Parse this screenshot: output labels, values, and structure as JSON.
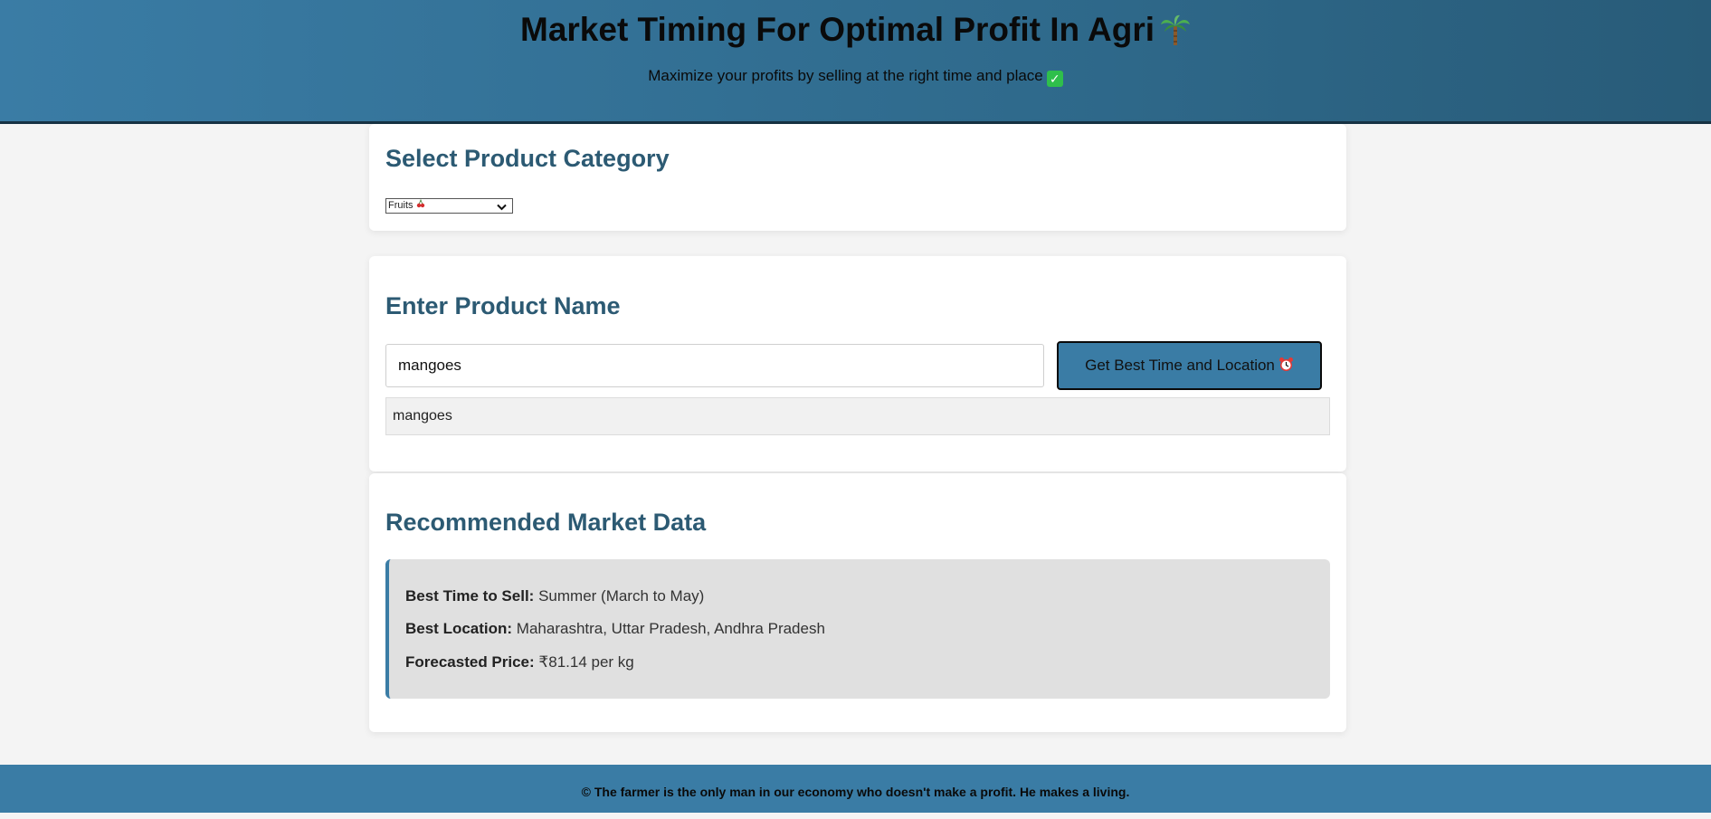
{
  "header": {
    "title": "Market Timing For Optimal Profit In Agri",
    "title_icon": "palm-tree-icon",
    "subtitle": "Maximize your profits by selling at the right time and place",
    "subtitle_icon": "check-mark-icon"
  },
  "category": {
    "heading": "Select Product Category",
    "selected": "Fruits",
    "selected_icon": "cherries-icon"
  },
  "product": {
    "heading": "Enter Product Name",
    "input_value": "mangoes",
    "button_label": "Get Best Time and Location",
    "button_icon": "alarm-clock-icon",
    "suggestion": "mangoes"
  },
  "results": {
    "heading": "Recommended Market Data",
    "best_time_label": "Best Time to Sell:",
    "best_time_value": "Summer (March to May)",
    "best_location_label": "Best Location:",
    "best_location_value": "Maharashtra, Uttar Pradesh, Andhra Pradesh",
    "forecast_label": "Forecasted Price:",
    "forecast_value": "₹81.14 per kg"
  },
  "footer": {
    "text": "© The farmer is the only man in our economy who doesn't make a profit. He makes a living."
  },
  "colors": {
    "accent": "#3a7ca5",
    "heading": "#2c5a73",
    "result_bg": "#e0e0e0"
  }
}
